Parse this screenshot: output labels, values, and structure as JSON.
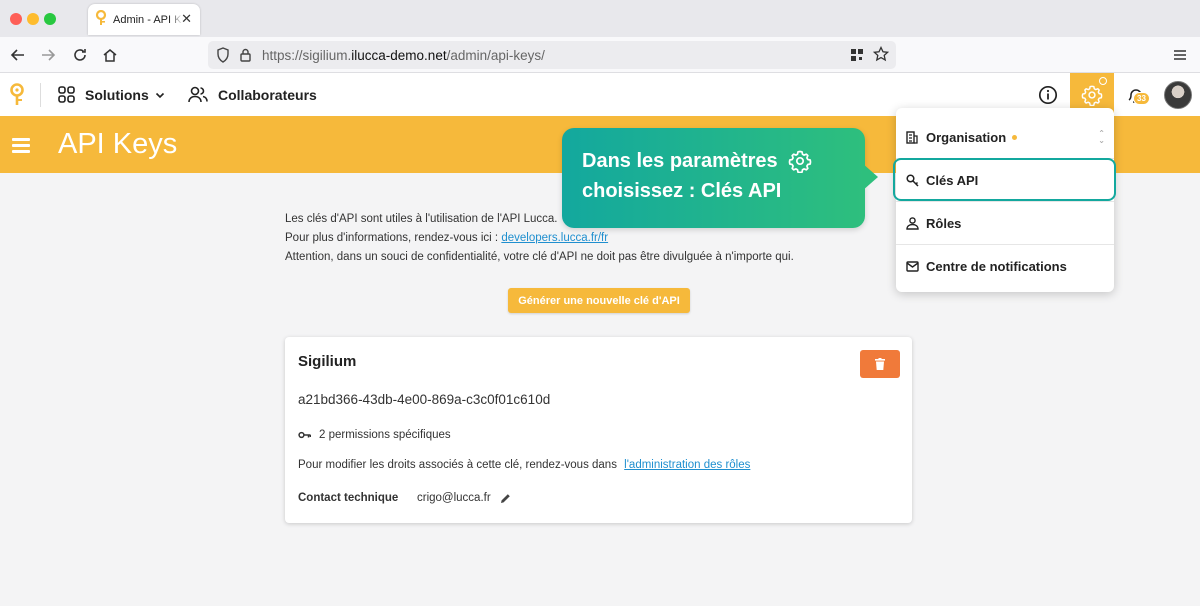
{
  "browser": {
    "tab_title": "Admin - API Keys",
    "url_prefix": "https://sigilium.",
    "url_host": "ilucca-demo.net",
    "url_path": "/admin/api-keys/"
  },
  "header": {
    "solutions_label": "Solutions",
    "collaborateurs_label": "Collaborateurs",
    "notification_count": "33"
  },
  "page": {
    "title": "API Keys",
    "intro_line1": "Les clés d'API sont utiles à l'utilisation de l'API Lucca.",
    "intro_line2_prefix": "Pour plus d'informations, rendez-vous ici :",
    "intro_link": "developers.lucca.fr/fr",
    "intro_line3": "Attention, dans un souci de confidentialité, votre clé d'API ne doit pas être divulguée à n'importe qui.",
    "generate_button": "Générer une nouvelle clé d'API"
  },
  "card": {
    "name": "Sigilium",
    "api_key": "a21bd366-43db-4e00-869a-c3c0f01c610d",
    "permissions": "2 permissions spécifiques",
    "modify_text": "Pour modifier les droits associés à cette clé, rendez-vous dans",
    "modify_link": "l'administration des rôles",
    "contact_label": "Contact technique",
    "contact_value": "crigo@lucca.fr"
  },
  "callout": {
    "line1": "Dans les paramètres",
    "line2": "choisissez : Clés API"
  },
  "dropdown": {
    "items": [
      {
        "label": "Organisation"
      },
      {
        "label": "Clés API"
      },
      {
        "label": "Rôles"
      },
      {
        "label": "Centre de notifications"
      }
    ]
  },
  "colors": {
    "brand_yellow": "#f6b93b",
    "callout_teal": "#13a89e",
    "callout_green": "#2ebf7d",
    "delete_orange": "#f07a3a",
    "link_blue": "#1f8fcf"
  }
}
